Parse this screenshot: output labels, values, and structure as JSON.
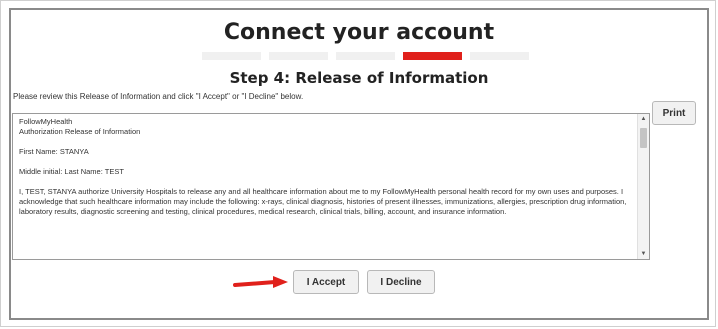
{
  "header": {
    "title": "Connect your account",
    "subtitle": "Step 4: Release of Information",
    "steps_total": 5,
    "active_step": 4
  },
  "instructions": "Please review this Release of Information and click \"I Accept\" or \"I Decline\" below.",
  "print_label": "Print",
  "release_text": {
    "line1": "FollowMyHealth",
    "line2": "Authorization Release of Information",
    "first_name": "First Name: STANYA",
    "middle_last": "Middle initial: Last Name: TEST",
    "body": "I, TEST, STANYA  authorize University Hospitals to release any and all healthcare information about me to my FollowMyHealth personal health record for my own uses and purposes. I acknowledge that such healthcare information may include the following: x-rays, clinical diagnosis, histories of present illnesses, immunizations, allergies, prescription drug information, laboratory results, diagnostic screening and testing, clinical procedures, medical research, clinical trials, billing, account, and insurance information."
  },
  "actions": {
    "accept_label": "I Accept",
    "decline_label": "I Decline"
  },
  "colors": {
    "accent_red": "#e0201b",
    "step_inactive": "#f0f0f0",
    "button_bg": "#f1f1f1"
  }
}
